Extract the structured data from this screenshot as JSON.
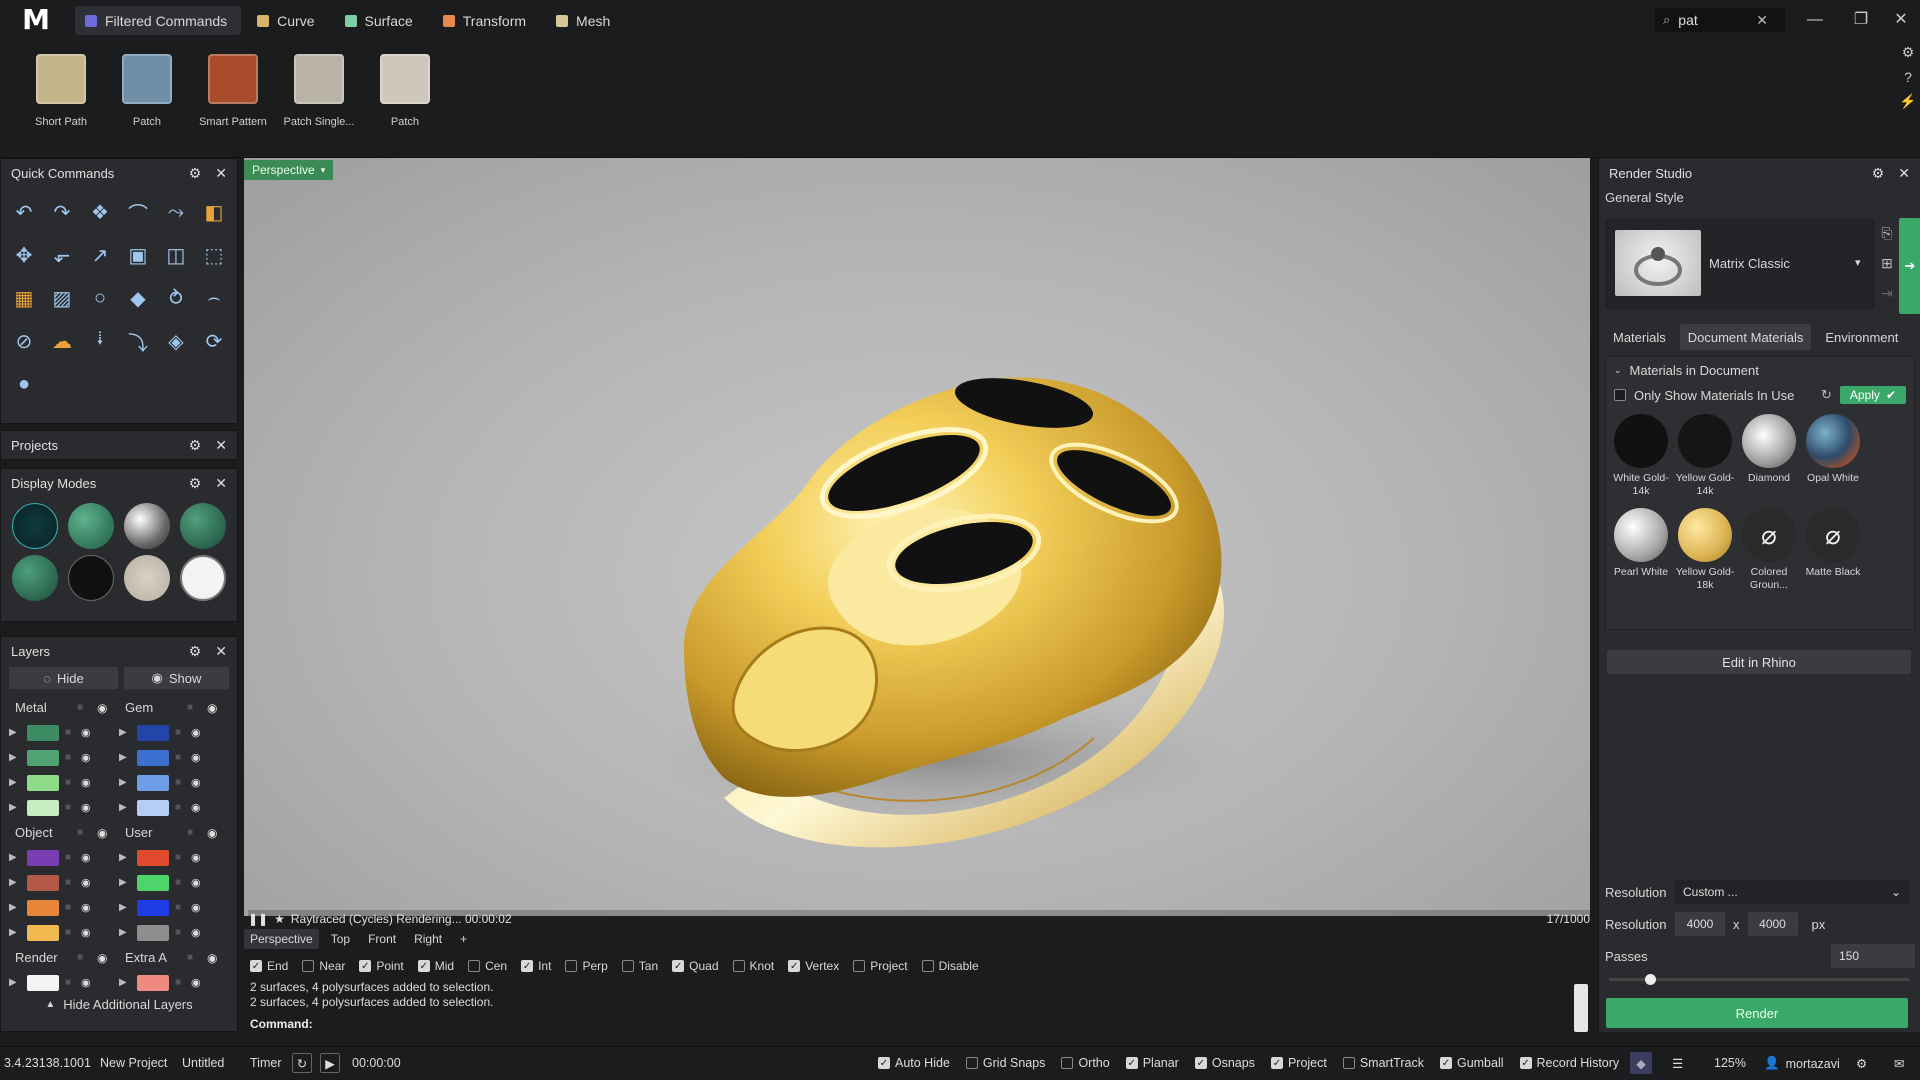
{
  "topbar": {
    "logo": "M",
    "tabs": [
      {
        "label": "Filtered Commands",
        "color": "#6b6bdc",
        "active": true
      },
      {
        "label": "Curve",
        "color": "#d8b46a"
      },
      {
        "label": "Surface",
        "color": "#7fcfa4"
      },
      {
        "label": "Transform",
        "color": "#e9874e"
      },
      {
        "label": "Mesh",
        "color": "#d4c89a"
      }
    ],
    "search": {
      "value": "pat",
      "icon": "search-icon"
    }
  },
  "ribbon": [
    {
      "label": "Short Path",
      "icon": "short-path-icon"
    },
    {
      "label": "Patch",
      "icon": "patch-icon"
    },
    {
      "label": "Smart Pattern",
      "icon": "smart-pattern-icon"
    },
    {
      "label": "Patch Single...",
      "icon": "patch-single-icon"
    },
    {
      "label": "Patch",
      "icon": "patch-mesh-icon"
    }
  ],
  "panels": {
    "quick_commands": "Quick Commands",
    "projects": "Projects",
    "display_modes": "Display Modes",
    "layers": "Layers"
  },
  "layers": {
    "hide": "Hide",
    "show": "Show",
    "groups": [
      {
        "left": {
          "name": "Metal",
          "colors": [
            "#3d8c64",
            "#4fa373",
            "#8edc8a",
            "#c6ecc0"
          ]
        },
        "right": {
          "name": "Gem",
          "colors": [
            "#2145a8",
            "#3b6fd0",
            "#6e9fe6",
            "#b6cdf4"
          ]
        }
      },
      {
        "left": {
          "name": "Object",
          "colors": [
            "#7a3eb4",
            "#b4584a",
            "#e7853a",
            "#f0b84e"
          ]
        },
        "right": {
          "name": "User",
          "colors": [
            "#e24a2e",
            "#4ed46c",
            "#1f3ce6",
            "#8e8e8e"
          ]
        }
      },
      {
        "left": {
          "name": "Render",
          "colors": [
            "#f4f4f4"
          ]
        },
        "right": {
          "name": "Extra A",
          "colors": [
            "#f08a80"
          ]
        }
      }
    ],
    "footer": "Hide Additional Layers"
  },
  "viewport": {
    "label": "Perspective",
    "status": "Raytraced (Cycles)  Rendering...  00:00:02",
    "progress": "17/1000",
    "tabs": [
      "Perspective",
      "Top",
      "Front",
      "Right"
    ]
  },
  "snaps": [
    {
      "label": "End",
      "on": true
    },
    {
      "label": "Near",
      "on": false
    },
    {
      "label": "Point",
      "on": true
    },
    {
      "label": "Mid",
      "on": true
    },
    {
      "label": "Cen",
      "on": false
    },
    {
      "label": "Int",
      "on": true
    },
    {
      "label": "Perp",
      "on": false
    },
    {
      "label": "Tan",
      "on": false
    },
    {
      "label": "Quad",
      "on": true
    },
    {
      "label": "Knot",
      "on": false
    },
    {
      "label": "Vertex",
      "on": true
    },
    {
      "label": "Project",
      "on": false
    },
    {
      "label": "Disable",
      "on": false
    }
  ],
  "command": {
    "history": [
      "2 surfaces, 4 polysurfaces added to selection.",
      "2 surfaces, 4 polysurfaces added to selection."
    ],
    "prompt": "Command:"
  },
  "render_studio": {
    "title": "Render Studio",
    "general_style": "General Style",
    "style_name": "Matrix Classic",
    "tabs": [
      "Materials",
      "Document Materials",
      "Environment"
    ],
    "section": "Materials in Document",
    "only_show": "Only Show Materials In Use",
    "apply": "Apply",
    "materials": [
      {
        "name": "White Gold-14k",
        "color": "#111"
      },
      {
        "name": "Yellow Gold-14k",
        "color": "#151515"
      },
      {
        "name": "Diamond",
        "color": "#cfcfcf"
      },
      {
        "name": "Opal White",
        "color": "#3a5a6a"
      },
      {
        "name": "Pearl White",
        "color": "#d9d9d9"
      },
      {
        "name": "Yellow Gold-18k",
        "color": "#e2c068"
      },
      {
        "name": "Colored Groun...",
        "color": "#2a2a2a"
      },
      {
        "name": "Matte Black",
        "color": "#2a2a2a"
      }
    ],
    "edit_in_rhino": "Edit in Rhino",
    "resolution_label": "Resolution",
    "resolution_preset": "Custom ...",
    "resolution_w": "4000",
    "resolution_h": "4000",
    "resolution_x": "x",
    "unit": "px",
    "passes_label": "Passes",
    "passes": "150",
    "render": "Render",
    "accent": "#3aa868"
  },
  "statusbar": {
    "coords": "3.4.23138.1001",
    "new_project": "New Project",
    "untitled": "Untitled",
    "timer": "Timer",
    "time": "00:00:00",
    "toggles": [
      {
        "label": "Auto Hide",
        "on": true
      },
      {
        "label": "Grid Snaps",
        "on": false
      },
      {
        "label": "Ortho",
        "on": false
      },
      {
        "label": "Planar",
        "on": true
      },
      {
        "label": "Osnaps",
        "on": true
      },
      {
        "label": "Project",
        "on": true
      },
      {
        "label": "SmartTrack",
        "on": false
      },
      {
        "label": "Gumball",
        "on": true
      },
      {
        "label": "Record History",
        "on": true
      }
    ],
    "zoom": "125%",
    "user": "mortazavi"
  }
}
